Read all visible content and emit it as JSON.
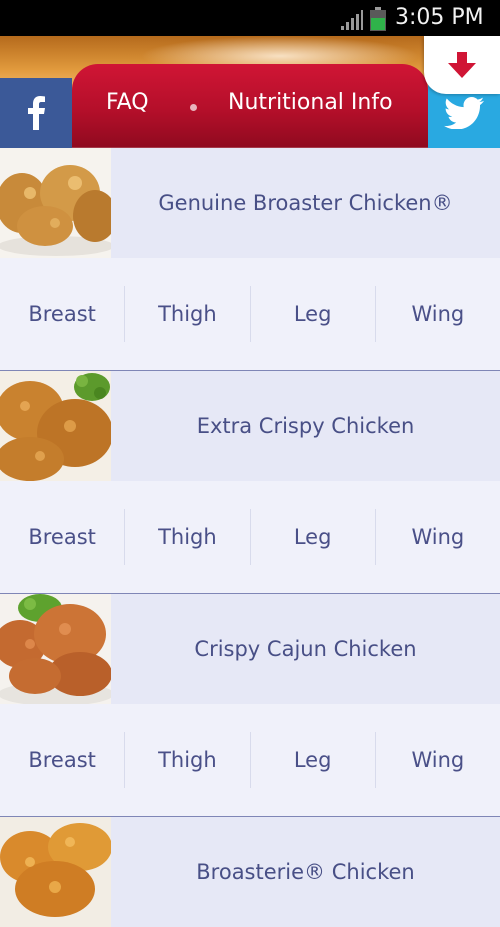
{
  "status_bar": {
    "time": "3:05 PM",
    "icons": [
      "signal-bars-icon",
      "battery-icon"
    ],
    "battery_color": "#2fb34a"
  },
  "header": {
    "nav_items": [
      "FAQ",
      "Nutritional Info"
    ],
    "social": [
      "facebook-icon",
      "twitter-icon"
    ],
    "download_icon": "down-arrow-icon",
    "colors": {
      "nav_red": "#b40f2a",
      "facebook_blue": "#3b5998",
      "twitter_blue": "#29a9e1",
      "download_red": "#d01535"
    }
  },
  "products": [
    {
      "name": "Genuine Broaster Chicken®",
      "cuts": [
        "Breast",
        "Thigh",
        "Leg",
        "Wing"
      ]
    },
    {
      "name": "Extra Crispy Chicken",
      "cuts": [
        "Breast",
        "Thigh",
        "Leg",
        "Wing"
      ]
    },
    {
      "name": "Crispy Cajun Chicken",
      "cuts": [
        "Breast",
        "Thigh",
        "Leg",
        "Wing"
      ]
    },
    {
      "name": "Broasterie® Chicken"
    }
  ],
  "text_color": "#484f86"
}
